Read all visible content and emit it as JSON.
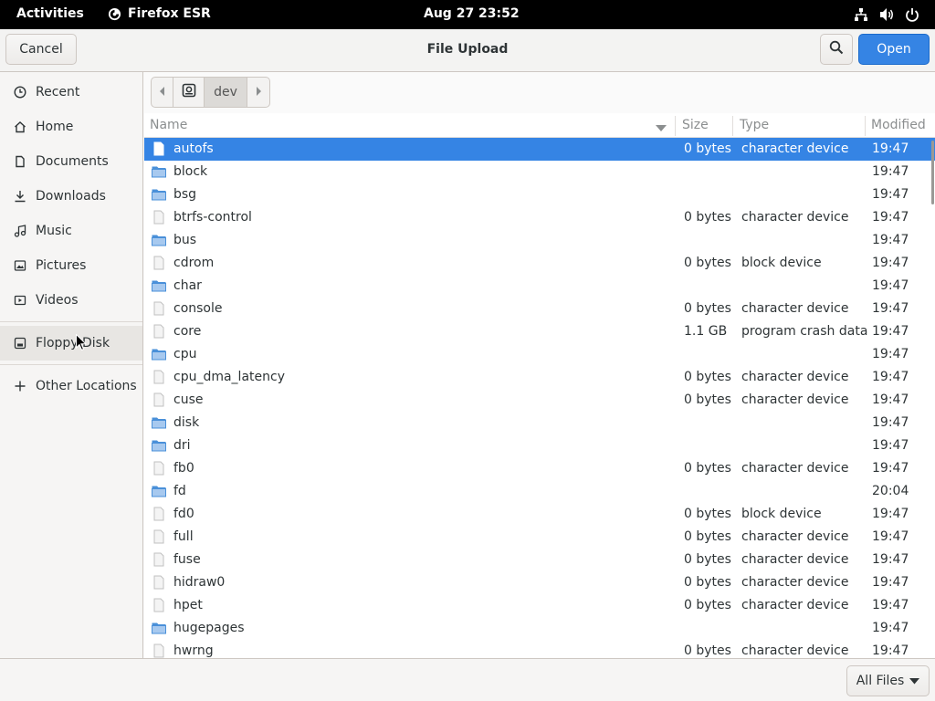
{
  "topbar": {
    "activities": "Activities",
    "app_name": "Firefox ESR",
    "clock": "Aug 27  23:52",
    "tray_icons": [
      "network-icon",
      "volume-icon",
      "power-icon"
    ]
  },
  "dialog": {
    "title": "File Upload",
    "cancel_label": "Cancel",
    "open_label": "Open"
  },
  "sidebar": {
    "items": [
      {
        "label": "Recent",
        "icon": "recent-icon"
      },
      {
        "label": "Home",
        "icon": "home-icon"
      },
      {
        "label": "Documents",
        "icon": "documents-icon"
      },
      {
        "label": "Downloads",
        "icon": "downloads-icon"
      },
      {
        "label": "Music",
        "icon": "music-icon"
      },
      {
        "label": "Pictures",
        "icon": "pictures-icon"
      },
      {
        "label": "Videos",
        "icon": "videos-icon"
      }
    ],
    "devices": [
      {
        "label": "Floppy Disk",
        "icon": "floppy-disk-icon"
      }
    ],
    "other": {
      "label": "Other Locations",
      "icon": "plus-icon"
    }
  },
  "pathbar": {
    "current": "dev"
  },
  "columns": {
    "name": "Name",
    "size": "Size",
    "type": "Type",
    "modified": "Modified"
  },
  "files": [
    {
      "name": "autofs",
      "kind": "file",
      "size": "0 bytes",
      "type": "character device",
      "modified": "19:47",
      "selected": true
    },
    {
      "name": "block",
      "kind": "folder",
      "size": "",
      "type": "",
      "modified": "19:47"
    },
    {
      "name": "bsg",
      "kind": "folder",
      "size": "",
      "type": "",
      "modified": "19:47"
    },
    {
      "name": "btrfs-control",
      "kind": "file",
      "size": "0 bytes",
      "type": "character device",
      "modified": "19:47"
    },
    {
      "name": "bus",
      "kind": "folder",
      "size": "",
      "type": "",
      "modified": "19:47"
    },
    {
      "name": "cdrom",
      "kind": "file",
      "size": "0 bytes",
      "type": "block device",
      "modified": "19:47"
    },
    {
      "name": "char",
      "kind": "folder",
      "size": "",
      "type": "",
      "modified": "19:47"
    },
    {
      "name": "console",
      "kind": "file",
      "size": "0 bytes",
      "type": "character device",
      "modified": "19:47"
    },
    {
      "name": "core",
      "kind": "file",
      "size": "1.1 GB",
      "type": "program crash data",
      "modified": "19:47"
    },
    {
      "name": "cpu",
      "kind": "folder",
      "size": "",
      "type": "",
      "modified": "19:47"
    },
    {
      "name": "cpu_dma_latency",
      "kind": "file",
      "size": "0 bytes",
      "type": "character device",
      "modified": "19:47"
    },
    {
      "name": "cuse",
      "kind": "file",
      "size": "0 bytes",
      "type": "character device",
      "modified": "19:47"
    },
    {
      "name": "disk",
      "kind": "folder",
      "size": "",
      "type": "",
      "modified": "19:47"
    },
    {
      "name": "dri",
      "kind": "folder",
      "size": "",
      "type": "",
      "modified": "19:47"
    },
    {
      "name": "fb0",
      "kind": "file",
      "size": "0 bytes",
      "type": "character device",
      "modified": "19:47"
    },
    {
      "name": "fd",
      "kind": "folder",
      "size": "",
      "type": "",
      "modified": "20:04"
    },
    {
      "name": "fd0",
      "kind": "file",
      "size": "0 bytes",
      "type": "block device",
      "modified": "19:47"
    },
    {
      "name": "full",
      "kind": "file",
      "size": "0 bytes",
      "type": "character device",
      "modified": "19:47"
    },
    {
      "name": "fuse",
      "kind": "file",
      "size": "0 bytes",
      "type": "character device",
      "modified": "19:47"
    },
    {
      "name": "hidraw0",
      "kind": "file",
      "size": "0 bytes",
      "type": "character device",
      "modified": "19:47"
    },
    {
      "name": "hpet",
      "kind": "file",
      "size": "0 bytes",
      "type": "character device",
      "modified": "19:47"
    },
    {
      "name": "hugepages",
      "kind": "folder",
      "size": "",
      "type": "",
      "modified": "19:47"
    },
    {
      "name": "hwrng",
      "kind": "file",
      "size": "0 bytes",
      "type": "character device",
      "modified": "19:47"
    }
  ],
  "footer": {
    "filter_label": "All Files"
  },
  "colors": {
    "accent": "#3584e4",
    "folder": "#4a90d9",
    "topbar_bg": "#000000"
  }
}
